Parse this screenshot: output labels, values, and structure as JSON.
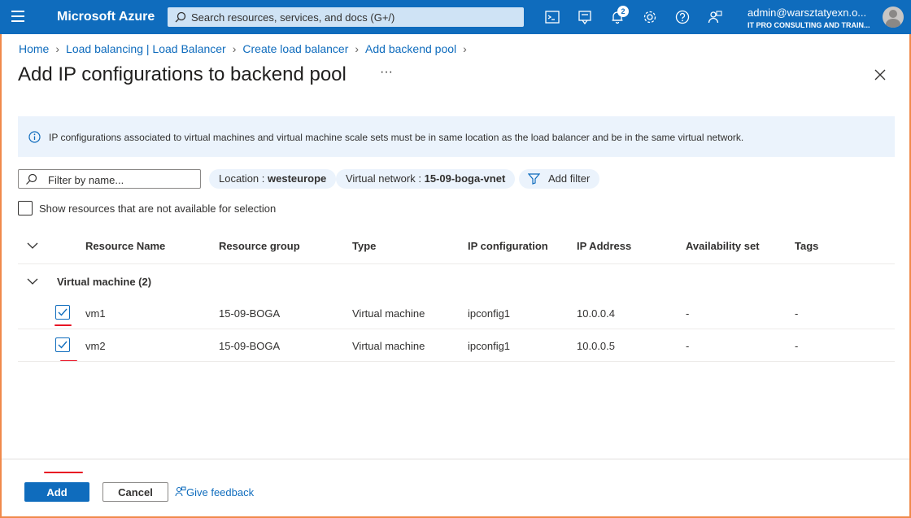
{
  "topbar": {
    "brand": "Microsoft Azure",
    "search_placeholder": "Search resources, services, and docs (G+/)",
    "notification_count": "2",
    "account_name": "admin@warsztatyexn.o...",
    "account_org": "IT PRO CONSULTING AND TRAIN..."
  },
  "breadcrumb": {
    "items": [
      "Home",
      "Load balancing | Load Balancer",
      "Create load balancer",
      "Add backend pool"
    ]
  },
  "page": {
    "title": "Add IP configurations to backend pool",
    "more": "···"
  },
  "info": {
    "text": "IP configurations associated to virtual machines and virtual machine scale sets must be in same location as the load balancer and be in the same virtual network."
  },
  "filters": {
    "search_placeholder": "Filter by name...",
    "location_label": "Location : ",
    "location_value": "westeurope",
    "vnet_label": "Virtual network : ",
    "vnet_value": "15-09-boga-vnet",
    "add_filter": "Add filter",
    "show_unavailable": "Show resources that are not available for selection"
  },
  "table": {
    "headers": [
      "Resource Name",
      "Resource group",
      "Type",
      "IP configuration",
      "IP Address",
      "Availability set",
      "Tags"
    ],
    "group_label": "Virtual machine (2)",
    "rows": [
      {
        "name": "vm1",
        "group": "15-09-BOGA",
        "type": "Virtual machine",
        "ipconfig": "ipconfig1",
        "ip": "10.0.0.4",
        "avset": "-",
        "tags": "-",
        "checked": true
      },
      {
        "name": "vm2",
        "group": "15-09-BOGA",
        "type": "Virtual machine",
        "ipconfig": "ipconfig1",
        "ip": "10.0.0.5",
        "avset": "-",
        "tags": "-",
        "checked": true
      }
    ]
  },
  "footer": {
    "add_label": "Add",
    "cancel_label": "Cancel",
    "feedback_label": "Give feedback"
  },
  "colors": {
    "accent": "#0f6cbd",
    "info_bg": "#ebf3fc",
    "highlight_red": "#e81123",
    "frame_orange": "#f08a4b"
  }
}
